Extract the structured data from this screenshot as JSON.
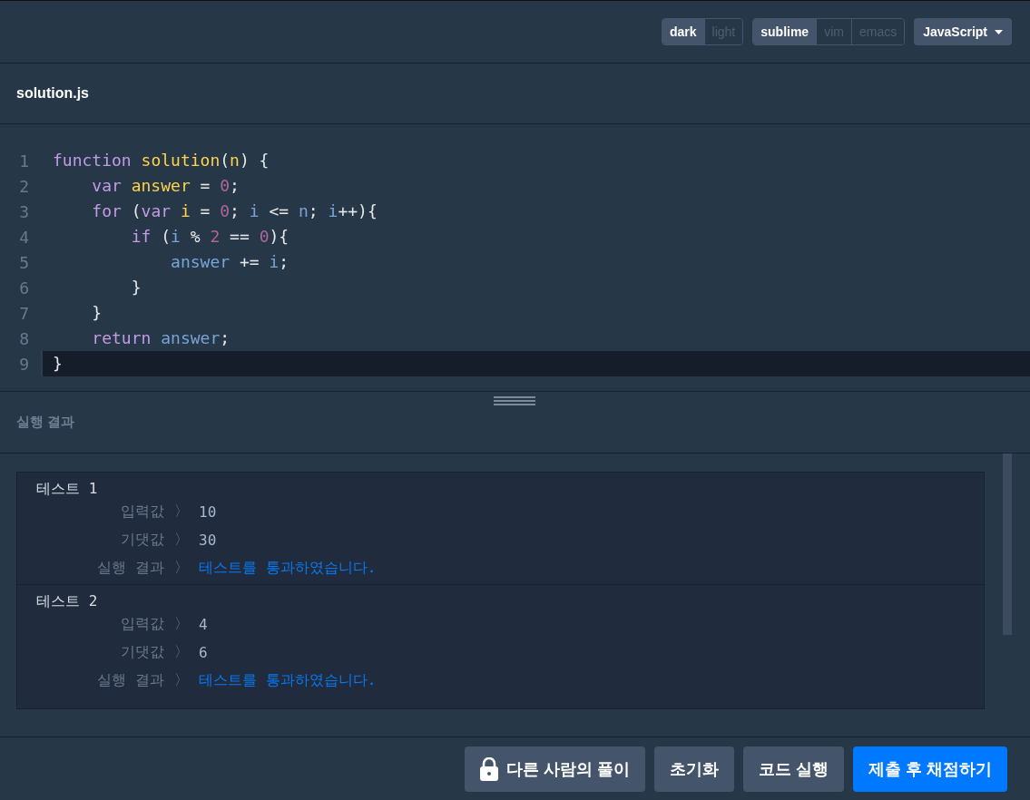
{
  "toolbar": {
    "themes": [
      {
        "label": "dark",
        "selected": true
      },
      {
        "label": "light",
        "selected": false
      }
    ],
    "keymaps": [
      {
        "label": "sublime",
        "selected": true
      },
      {
        "label": "vim",
        "selected": false
      },
      {
        "label": "emacs",
        "selected": false
      }
    ],
    "language": "JavaScript"
  },
  "file_tab": "solution.js",
  "editor": {
    "lines": [
      {
        "number": "1",
        "active": false,
        "tokens": [
          {
            "kind": "keyword",
            "text": "function"
          },
          {
            "kind": "def",
            "text": " solution"
          },
          {
            "kind": "plain",
            "text": "("
          },
          {
            "kind": "def",
            "text": "n"
          },
          {
            "kind": "plain",
            "text": ") {"
          }
        ]
      },
      {
        "number": "2",
        "active": false,
        "tokens": [
          {
            "kind": "keyword",
            "text": "    var"
          },
          {
            "kind": "def",
            "text": " answer"
          },
          {
            "kind": "plain",
            "text": " = "
          },
          {
            "kind": "number",
            "text": "0"
          },
          {
            "kind": "plain",
            "text": ";"
          }
        ]
      },
      {
        "number": "3",
        "active": false,
        "tokens": [
          {
            "kind": "keyword",
            "text": "    for"
          },
          {
            "kind": "plain",
            "text": " ("
          },
          {
            "kind": "keyword",
            "text": "var"
          },
          {
            "kind": "def",
            "text": " i"
          },
          {
            "kind": "plain",
            "text": " = "
          },
          {
            "kind": "number",
            "text": "0"
          },
          {
            "kind": "plain",
            "text": "; "
          },
          {
            "kind": "variable",
            "text": "i"
          },
          {
            "kind": "plain",
            "text": " <= "
          },
          {
            "kind": "variable",
            "text": "n"
          },
          {
            "kind": "plain",
            "text": "; "
          },
          {
            "kind": "variable",
            "text": "i"
          },
          {
            "kind": "plain",
            "text": "++){"
          }
        ]
      },
      {
        "number": "4",
        "active": false,
        "tokens": [
          {
            "kind": "keyword",
            "text": "        if"
          },
          {
            "kind": "plain",
            "text": " ("
          },
          {
            "kind": "variable",
            "text": "i"
          },
          {
            "kind": "plain",
            "text": " % "
          },
          {
            "kind": "number",
            "text": "2"
          },
          {
            "kind": "plain",
            "text": " == "
          },
          {
            "kind": "number",
            "text": "0"
          },
          {
            "kind": "plain",
            "text": "){"
          }
        ]
      },
      {
        "number": "5",
        "active": false,
        "tokens": [
          {
            "kind": "variable",
            "text": "            answer"
          },
          {
            "kind": "plain",
            "text": " += "
          },
          {
            "kind": "variable",
            "text": "i"
          },
          {
            "kind": "plain",
            "text": ";"
          }
        ]
      },
      {
        "number": "6",
        "active": false,
        "tokens": [
          {
            "kind": "plain",
            "text": "        }"
          }
        ]
      },
      {
        "number": "7",
        "active": false,
        "tokens": [
          {
            "kind": "plain",
            "text": "    }"
          }
        ]
      },
      {
        "number": "8",
        "active": false,
        "tokens": [
          {
            "kind": "keyword",
            "text": "    return"
          },
          {
            "kind": "variable",
            "text": " answer"
          },
          {
            "kind": "plain",
            "text": ";"
          }
        ]
      },
      {
        "number": "9",
        "active": true,
        "tokens": [
          {
            "kind": "plain",
            "text": "}"
          }
        ]
      }
    ]
  },
  "results": {
    "title": "실행 결과",
    "tests": [
      {
        "title": "테스트 1",
        "rows": [
          {
            "label": "입력값",
            "arrow": "〉",
            "value": "10",
            "kind": "value"
          },
          {
            "label": "기댓값",
            "arrow": "〉",
            "value": "30",
            "kind": "value"
          },
          {
            "label": "실행 결과",
            "arrow": "〉",
            "value": "테스트를 통과하였습니다.",
            "kind": "pass"
          }
        ]
      },
      {
        "title": "테스트 2",
        "rows": [
          {
            "label": "입력값",
            "arrow": "〉",
            "value": "4",
            "kind": "value"
          },
          {
            "label": "기댓값",
            "arrow": "〉",
            "value": "6",
            "kind": "value"
          },
          {
            "label": "실행 결과",
            "arrow": "〉",
            "value": "테스트를 통과하였습니다.",
            "kind": "pass"
          }
        ]
      }
    ]
  },
  "buttons": [
    {
      "label": "다른 사람의 풀이",
      "kind": "locked"
    },
    {
      "label": "초기화",
      "kind": "secondary"
    },
    {
      "label": "코드 실행",
      "kind": "secondary"
    },
    {
      "label": "제출 후 채점하기",
      "kind": "primary"
    }
  ]
}
